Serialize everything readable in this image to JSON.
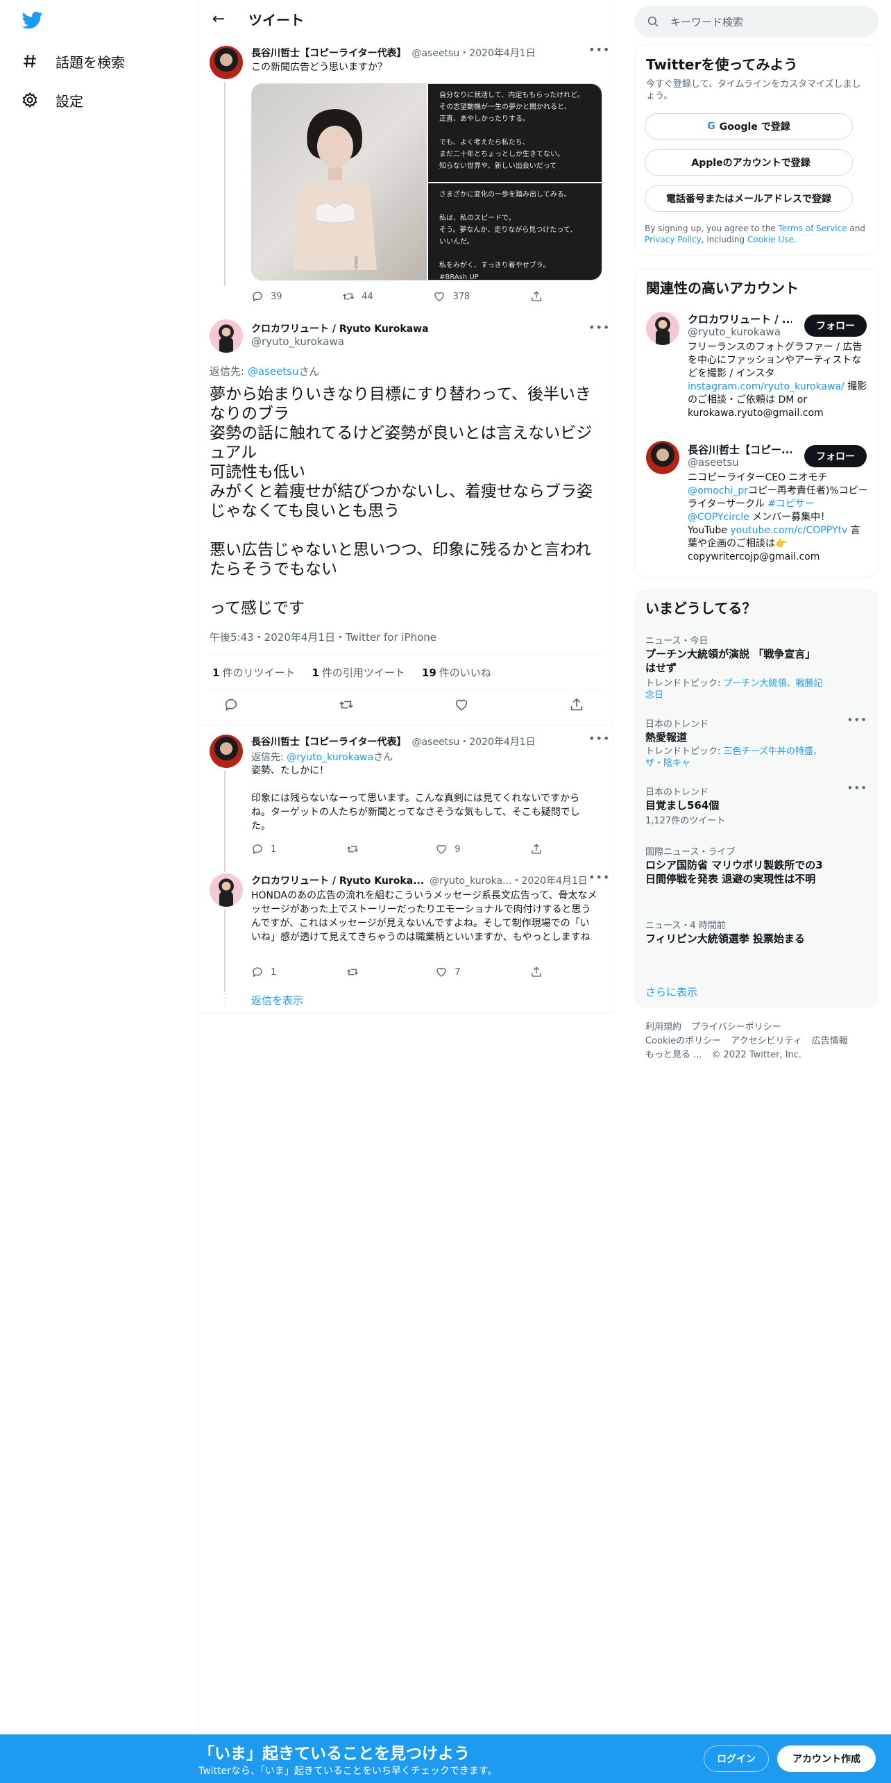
{
  "nav": {
    "logo": "twitter-bird-icon",
    "items": [
      {
        "label": "話題を検索",
        "icon": "hashtag-icon"
      },
      {
        "label": "設定",
        "icon": "gear-icon"
      }
    ]
  },
  "header": {
    "title": "ツイート",
    "back_icon": "←"
  },
  "original_tweet": {
    "name": "長谷川哲士【コピーライター代表】",
    "handle": "@aseetsu",
    "date": "・2020年4月1日",
    "text": "この新聞広告どう思いますか？",
    "media_top": "自分なりに就活して、内定ももらったけれど。\nその志望動機が一生の夢かと聞かれると、\n正直、あやしかったりする。\n\nでも、よく考えたら私たち、\nまだ二十年とちょっとしか生きてない。\n知らない世界や、新しい出会いだって",
    "media_bottom": "さまざかに変化の一歩を踏み出してみる。\n\n私は、私のスピードで。\nそう。夢なんか、走りながら見つけたって、\nいいんだ。\n\n私をみがく、すっきり着やせブラ。\n#BRAsh UP",
    "replies": "39",
    "retweets": "44",
    "likes": "378"
  },
  "main_tweet": {
    "name": "クロカワリュート / Ryuto Kurokawa",
    "handle": "@ryuto_kurokawa",
    "reply_to_prefix": "返信先: ",
    "reply_to_handle": "@aseetsu",
    "reply_to_suffix": "さん",
    "text": "夢から始まりいきなり目標にすり替わって、後半いきなりのブラ\n姿勢の話に触れてるけど姿勢が良いとは言えないビジュアル\n可読性も低い\nみがくと着痩せが結びつかないし、着痩せならブラ姿じゃなくても良いとも思う\n\n悪い広告じゃないと思いつつ、印象に残るかと言われたらそうでもない\n\nって感じです",
    "time": "午後5:43・2020年4月1日・Twitter for iPhone",
    "retweet_count": "1",
    "retweet_label": "件のリツイート",
    "quote_count": "1",
    "quote_label": "件の引用ツイート",
    "like_count": "19",
    "like_label": "件のいいね"
  },
  "reply1": {
    "name": "長谷川哲士【コピーライター代表】",
    "handle": "@aseetsu",
    "date": "・2020年4月1日",
    "reply_to_prefix": "返信先: ",
    "reply_to_handle": "@ryuto_kurokawa",
    "reply_to_suffix": "さん",
    "text": "姿勢、たしかに！\n\n印象には残らないなーって思います。こんな真剣には見てくれないですからね。ターゲットの人たちが新聞とってなさそうな気もして、そこも疑問でした。",
    "replies": "1",
    "retweets": "",
    "likes": "9"
  },
  "reply2": {
    "name": "クロカワリュート / Ryuto Kuroka...",
    "handle": "@ryuto_kuroka...",
    "date": "・2020年4月1日",
    "text": "HONDAのあの広告の流れを組むこういうメッセージ系長文広告って、骨太なメッセージがあった上でストーリーだったりエモーショナルで肉付けすると思うんですが、これはメッセージが見えないんですよね。そして制作現場での「いいね」感が透けて見えてきちゃうのは職業柄といいますか、もやっとしますね",
    "replies": "1",
    "retweets": "",
    "likes": "7"
  },
  "show_replies": "返信を表示",
  "search": {
    "placeholder": "キーワード検索"
  },
  "signup_card": {
    "title": "Twitterを使ってみよう",
    "subtitle": "今すぐ登録して、タイムラインをカスタマイズしましょう。",
    "google": "Google で登録",
    "apple": "Appleのアカウントで登録",
    "phone": "電話番号またはメールアドレスで登録",
    "legal_prefix": "By signing up, you agree to the ",
    "terms": "Terms of Service",
    "legal_and": " and ",
    "privacy": "Privacy Policy",
    "legal_including": ", including ",
    "cookie": "Cookie Use",
    "legal_end": "."
  },
  "related": {
    "title": "関連性の高いアカウント",
    "follow": "フォロー",
    "accounts": [
      {
        "name": "クロカワリュート / ...",
        "handle": "@ryuto_kurokawa",
        "bio_1": "フリーランスのフォトグラファー / 広告を中心にファッションやアーティストなどを撮影 / インスタ ",
        "bio_link": "instagram.com/ryuto_kurokawa/",
        "bio_2": " 撮影のご相談・ご依頼は DM or kurokawa.ryuto@gmail.com"
      },
      {
        "name": "長谷川哲士【コピー...",
        "handle": "@aseetsu",
        "bio_1": "ニコピーライターCEO ニオモチ",
        "bio_link1": "@omochi_pr",
        "bio_2": "コピー再考責任者)%コピーライターサークル ",
        "bio_link2": "#コピサー",
        "bio_3": " ",
        "bio_link3": "@COPYcircle",
        "bio_4": " メンバー募集中！YouTube ",
        "bio_link4": "youtube.com/c/COPPYtv",
        "bio_5": " 言葉や企画のご相談は👉 copywritercojp@gmail.com"
      }
    ]
  },
  "trends": {
    "title": "いまどうしてる？",
    "items": [
      {
        "label": "ニュース・今日",
        "title": "プーチン大統領が演説 「戦争宣言」はせず",
        "sub_prefix": "トレンドトピック: ",
        "sub_link": "プーチン大統領、戦勝記念日"
      },
      {
        "label": "日本のトレンド",
        "title": "熱愛報道",
        "sub_prefix": "トレンドトピック: ",
        "sub_link": "三色チーズ牛丼の特盛、ザ・陰キャ"
      },
      {
        "label": "日本のトレンド",
        "title": "目覚まし564個",
        "sub_prefix": "1,127件のツイート",
        "sub_link": ""
      },
      {
        "label": "国際ニュース・ライブ",
        "title": "ロシア国防省 マリウポリ製鉄所での3日間停戦を発表 退避の実現性は不明",
        "sub_prefix": "",
        "sub_link": ""
      },
      {
        "label": "ニュース・4 時間前",
        "title": "フィリピン大統領選挙 投票始まる",
        "sub_prefix": "",
        "sub_link": ""
      }
    ],
    "show_more": "さらに表示"
  },
  "footer": {
    "line1": [
      "利用規約",
      "プライバシーポリシー"
    ],
    "line2": [
      "Cookieのポリシー",
      "アクセシビリティ",
      "広告情報"
    ],
    "line3": [
      "もっと見る ...",
      "© 2022 Twitter, Inc."
    ]
  },
  "bottom_bar": {
    "title": "「いま」起きていることを見つけよう",
    "subtitle": "Twitterなら、「いま」起きていることをいち早くチェックできます。",
    "login": "ログイン",
    "signup": "アカウント作成"
  },
  "colors": {
    "accent": "#1d9bf0",
    "text": "#0f1419",
    "muted": "#536471"
  }
}
